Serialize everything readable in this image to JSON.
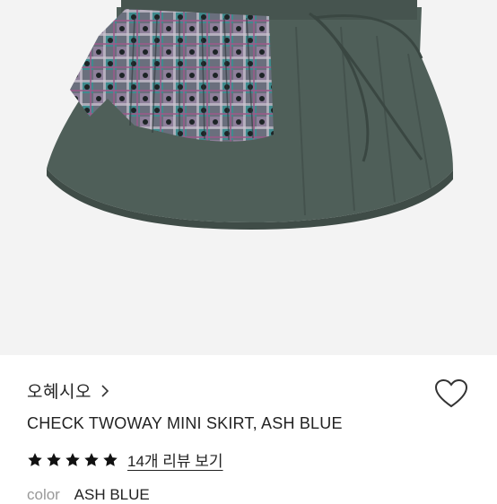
{
  "product": {
    "image_alt": "check twoway mini skirt product photo",
    "brand": "오혜시오",
    "title": "CHECK TWOWAY MINI SKIRT, ASH BLUE",
    "rating_stars": 5,
    "review_link": "14개 리뷰 보기",
    "color_label": "color",
    "color_value": "ASH BLUE"
  },
  "colors": {
    "skirt": "#4f5f59",
    "background": "#f3f3f3",
    "star": "#111111"
  },
  "icons": {
    "brand_chevron": "chevron-right-icon",
    "wishlist": "heart-outline-icon",
    "star": "star-icon"
  }
}
